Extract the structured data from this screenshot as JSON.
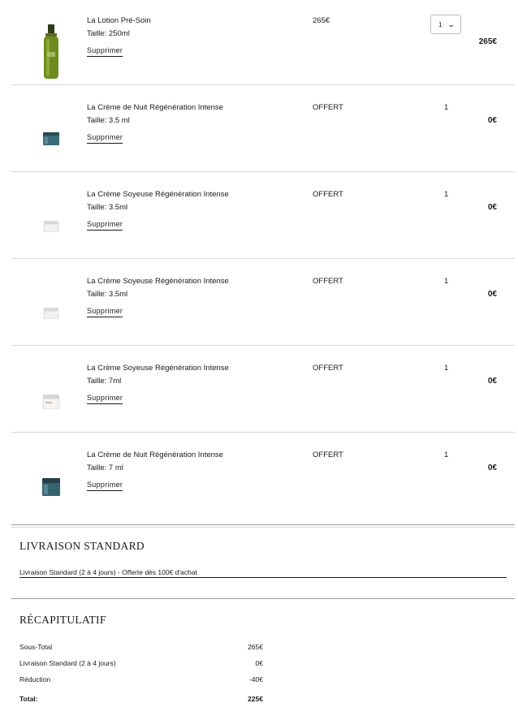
{
  "cart": {
    "remove_label": "Supprimer",
    "items": [
      {
        "name": "La Lotion Pré-Soin",
        "size": "Taille: 250ml",
        "price": "265€",
        "qty": "1",
        "total": "265€",
        "image": "green-bottle-image"
      },
      {
        "name": "La Crème de Nuit Régénération Intense",
        "size": "Taille: 3.5 ml",
        "price": "OFFERT",
        "qty": "1",
        "total": "0€",
        "image": "teal-jar-image"
      },
      {
        "name": "La Crème Soyeuse Régénération Intense",
        "size": "Taille: 3.5ml",
        "price": "OFFERT",
        "qty": "1",
        "total": "0€",
        "image": "white-jar-image"
      },
      {
        "name": "La Crème Soyeuse Régénération Intense",
        "size": "Taille: 3.5ml",
        "price": "OFFERT",
        "qty": "1",
        "total": "0€",
        "image": "white-jar-image"
      },
      {
        "name": "La Crème Soyeuse Régénération Intense",
        "size": "Taille: 7ml",
        "price": "OFFERT",
        "qty": "1",
        "total": "0€",
        "image": "white-jar-image"
      },
      {
        "name": "La Crème de Nuit Régénération Intense",
        "size": "Taille: 7 ml",
        "price": "OFFERT",
        "qty": "1",
        "total": "0€",
        "image": "teal-jar-image"
      }
    ]
  },
  "shipping": {
    "title": "LIVRAISON STANDARD",
    "option": "Livraison Standard (2 à 4 jours) - Offerte dès 100€ d'achat"
  },
  "summary": {
    "title": "RÉCAPITULATIF",
    "lines": [
      {
        "label": "Sous-Total",
        "value": "265€"
      },
      {
        "label": "Livraison Standard (2 à 4 jours)",
        "value": "0€"
      },
      {
        "label": "Réduction",
        "value": "-40€"
      }
    ],
    "total_label": "Total:",
    "total_value": "225€"
  }
}
